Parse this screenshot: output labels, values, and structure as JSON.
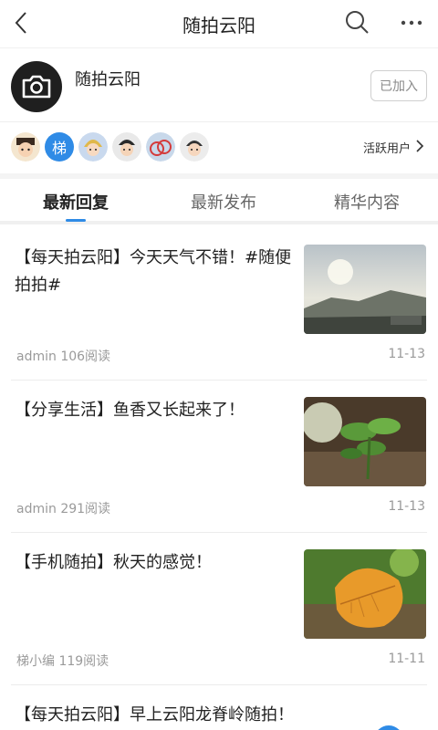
{
  "topbar": {
    "title": "随拍云阳"
  },
  "group": {
    "name": "随拍云阳",
    "join_label": "已加入"
  },
  "active_users": {
    "label": "活跃用户",
    "avatar_badge": "梯"
  },
  "tabs": [
    {
      "label": "最新回复"
    },
    {
      "label": "最新发布"
    },
    {
      "label": "精华内容"
    }
  ],
  "posts": [
    {
      "title": "【每天拍云阳】今天天气不错！#随便拍拍#",
      "meta": "admin 106阅读",
      "date": "11-13"
    },
    {
      "title": "【分享生活】鱼香又长起来了！",
      "meta": "admin 291阅读",
      "date": "11-13"
    },
    {
      "title": "【手机随拍】秋天的感觉！",
      "meta": "梯小编 119阅读",
      "date": "11-11"
    },
    {
      "title": "【每天拍云阳】早上云阳龙脊岭随拍！",
      "meta": "",
      "date": ""
    }
  ],
  "colors": {
    "accent": "#2f8be6",
    "text": "#222222",
    "muted": "#9a9a9a"
  }
}
